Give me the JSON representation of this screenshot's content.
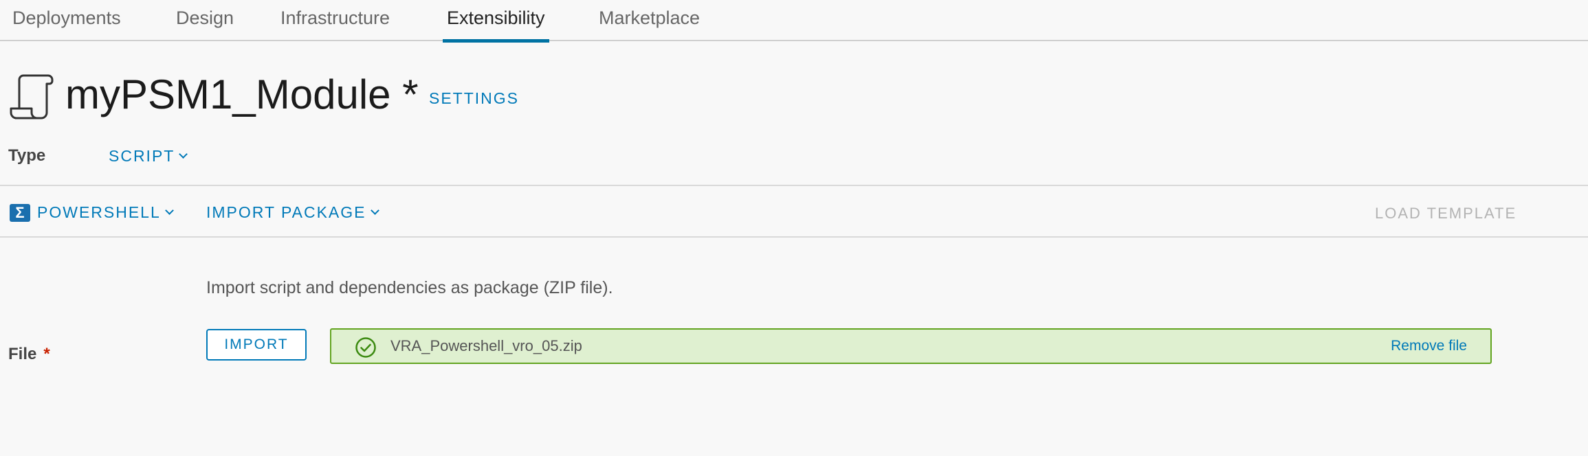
{
  "nav": {
    "tabs": [
      {
        "label": "Deployments",
        "active": false
      },
      {
        "label": "Design",
        "active": false
      },
      {
        "label": "Infrastructure",
        "active": false
      },
      {
        "label": "Extensibility",
        "active": true
      },
      {
        "label": "Marketplace",
        "active": false
      }
    ]
  },
  "header": {
    "icon": "script-scroll-icon",
    "title": "myPSM1_Module *",
    "settings_label": "SETTINGS"
  },
  "type_row": {
    "label": "Type",
    "value": "SCRIPT"
  },
  "toolbar": {
    "language_icon": "powershell-icon",
    "language_icon_glyph": "Σ",
    "language": "POWERSHELL",
    "import_package": "IMPORT PACKAGE",
    "load_template": "LOAD TEMPLATE"
  },
  "content": {
    "help_text": "Import script and dependencies as package (ZIP file).",
    "file_label": "File",
    "required_marker": "*",
    "import_button": "IMPORT",
    "file_name": "VRA_Powershell_vro_05.zip",
    "file_status_icon": "check-circle-icon",
    "remove_file": "Remove file"
  },
  "colors": {
    "accent": "#0079b8",
    "active_tab_underline": "#0072a3",
    "success_border": "#62a420",
    "success_bg": "#dff0d0",
    "required": "#c92100",
    "disabled": "#b3b3b3"
  }
}
